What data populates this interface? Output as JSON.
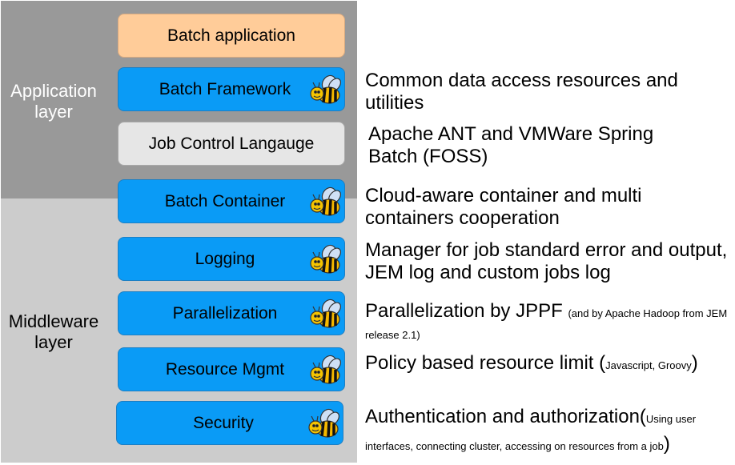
{
  "layers": {
    "application": "Application layer",
    "middleware": "Middleware layer"
  },
  "colors": {
    "application_bg": "#999999",
    "middleware_bg": "#cccccc",
    "component_blue": "#0a9bf6",
    "batch_app": "#ffcc99",
    "jcl": "#e6e6e6"
  },
  "components": [
    {
      "label": "Batch application",
      "icon": "none"
    },
    {
      "label": "Batch Framework",
      "icon": "bee-icon"
    },
    {
      "label": "Job Control Langauge",
      "icon": "none"
    },
    {
      "label": "Batch Container",
      "icon": "bee-icon"
    },
    {
      "label": "Logging",
      "icon": "bee-icon"
    },
    {
      "label": "Parallelization",
      "icon": "bee-icon"
    },
    {
      "label": "Resource Mgmt",
      "icon": "bee-icon"
    },
    {
      "label": "Security",
      "icon": "bee-icon"
    }
  ],
  "descriptions": {
    "framework": "Common data access resources and utilities",
    "jcl": "Apache ANT and VMWare Spring Batch (FOSS)",
    "container": "Cloud-aware container and multi containers cooperation",
    "logging": "Manager for job standard error and output, JEM log and custom jobs log",
    "parallel_main": "Parallelization by JPPF ",
    "parallel_note": "(and by Apache Hadoop from JEM release 2.1)",
    "resource_main": "Policy based resource limit (",
    "resource_note": "Javascript, Groovy",
    "resource_close": ")",
    "security_main": "Authentication and authorization(",
    "security_note": "Using user interfaces, connecting cluster, accessing on resources from a job",
    "security_close": ")"
  }
}
